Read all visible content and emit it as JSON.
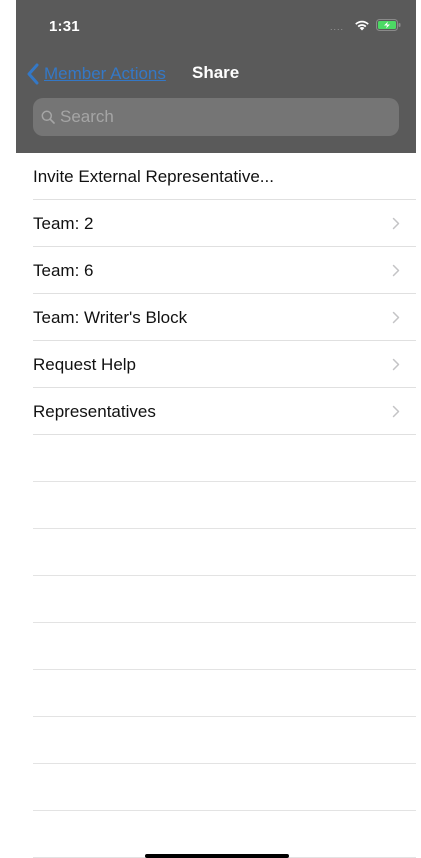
{
  "status_bar": {
    "time": "1:31",
    "signal": "....",
    "icons": [
      "wifi-icon",
      "battery-charging-icon"
    ]
  },
  "nav": {
    "back_label": "Member Actions",
    "title": "Share",
    "accent_color": "#3478c6"
  },
  "search": {
    "placeholder": "Search",
    "value": ""
  },
  "list": {
    "items": [
      {
        "label": "Invite External Representative...",
        "has_chevron": false
      },
      {
        "label": "Team: 2",
        "has_chevron": true
      },
      {
        "label": "Team: 6",
        "has_chevron": true
      },
      {
        "label": "Team: Writer's Block",
        "has_chevron": true
      },
      {
        "label": "Request Help",
        "has_chevron": true
      },
      {
        "label": "Representatives",
        "has_chevron": true
      }
    ]
  },
  "colors": {
    "header_bg": "#5a5a5a",
    "search_bg": "#757575",
    "separator": "#e0e0e0"
  }
}
